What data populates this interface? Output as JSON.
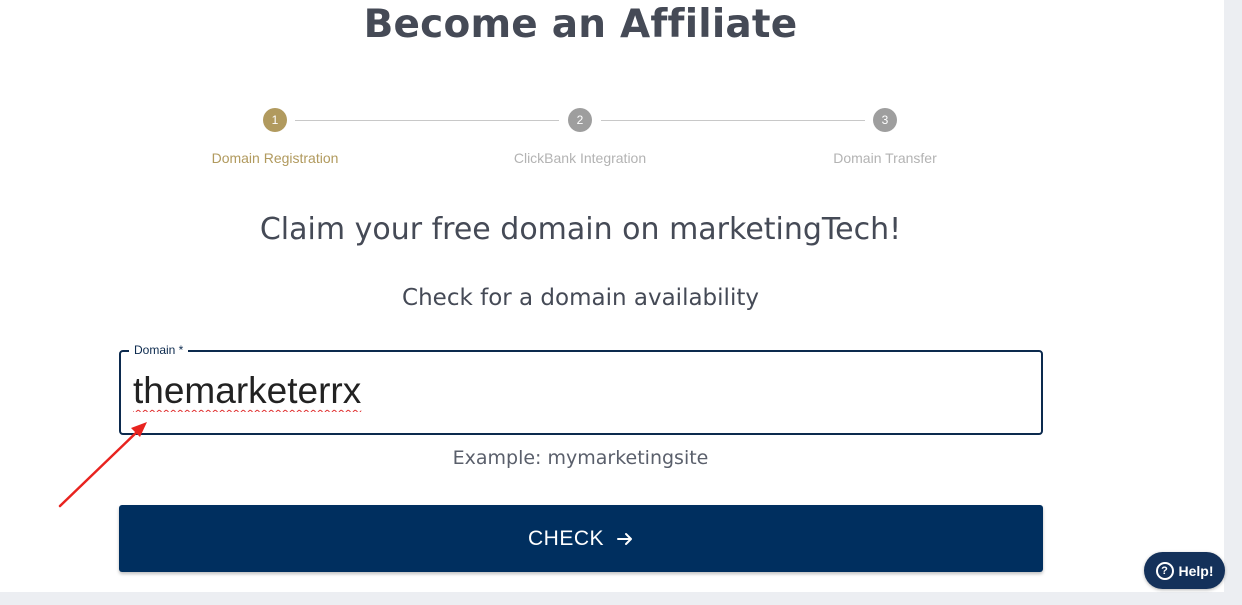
{
  "page": {
    "title": "Become an Affiliate",
    "heading": "Claim your free domain on marketingTech!",
    "subheading": "Check for a domain availability"
  },
  "stepper": {
    "steps": [
      {
        "number": "1",
        "label": "Domain Registration",
        "state": "active"
      },
      {
        "number": "2",
        "label": "ClickBank Integration",
        "state": "inactive"
      },
      {
        "number": "3",
        "label": "Domain Transfer",
        "state": "inactive"
      }
    ]
  },
  "domain_field": {
    "label": "Domain *",
    "value": "themarketerrx",
    "helper": "Example: mymarketingsite"
  },
  "check_button": {
    "label": "CHECK",
    "icon": "arrow-right-icon"
  },
  "help_button": {
    "label": "Help!",
    "icon": "question-circle-icon"
  },
  "colors": {
    "accent_gold": "#b19a5e",
    "primary_navy": "#002f5f",
    "text_dark": "#454a56",
    "annotation_red": "#e8231f"
  }
}
